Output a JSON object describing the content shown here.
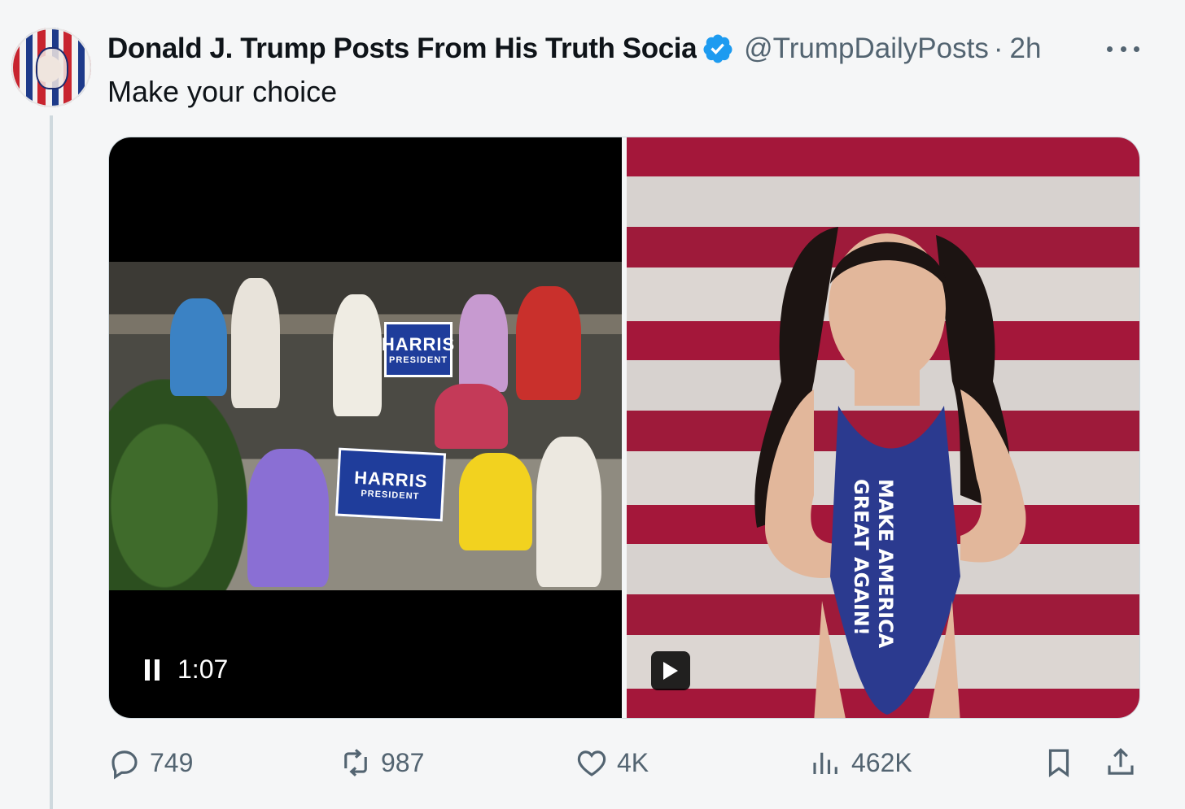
{
  "post": {
    "author_name": "Donald J. Trump Posts From His Truth Socia",
    "handle": "@TrumpDailyPosts",
    "separator": "·",
    "time": "2h",
    "text": "Make your choice"
  },
  "media": {
    "left_video": {
      "timestamp": "1:07",
      "sign_main": "HARRIS",
      "sign_sub": "PRESIDENT"
    },
    "right_video": {
      "swimsuit_text_line1": "MAKE AMERICA",
      "swimsuit_text_line2": "GREAT AGAIN!"
    }
  },
  "actions": {
    "replies": "749",
    "reposts": "987",
    "likes": "4K",
    "views": "462K"
  },
  "colors": {
    "verified": "#1d9bf0",
    "muted_text": "#536471",
    "text": "#0f1419"
  },
  "icons": [
    "more-icon",
    "verified-badge-icon",
    "pause-icon",
    "play-icon",
    "reply-icon",
    "repost-icon",
    "like-icon",
    "views-icon",
    "bookmark-icon",
    "share-icon"
  ]
}
